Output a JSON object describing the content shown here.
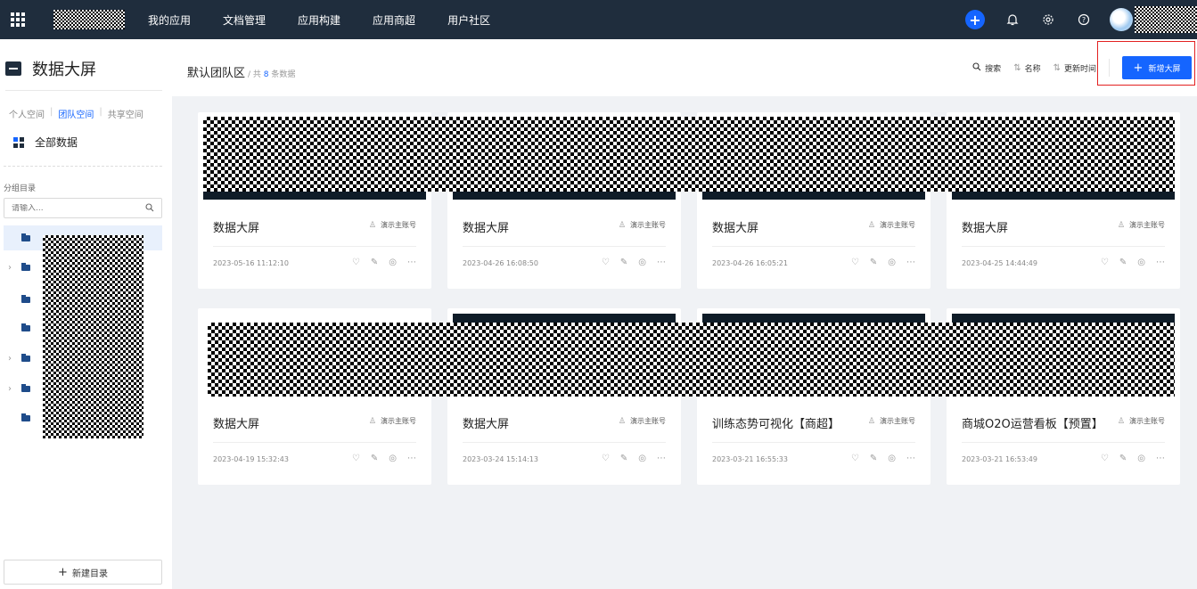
{
  "topnav": {
    "items": [
      {
        "label": "我的应用"
      },
      {
        "label": "文档管理"
      },
      {
        "label": "应用构建"
      },
      {
        "label": "应用商超"
      },
      {
        "label": "用户社区"
      }
    ],
    "icons": [
      "apps-grid-icon",
      "plus-icon",
      "bell-icon",
      "gear-icon",
      "help-icon"
    ]
  },
  "sidebar": {
    "title": "数据大屏",
    "space_tabs": [
      "个人空间",
      "团队空间",
      "共享空间"
    ],
    "active_space": "团队空间",
    "all_data": "全部数据",
    "group_label": "分组目录",
    "search_placeholder": "请输入...",
    "new_dir": "新建目录"
  },
  "header": {
    "title": "默认团队区",
    "count_prefix": "/ 共 ",
    "count": "8",
    "count_suffix": " 条数据",
    "search": "搜索",
    "sort_name": "名称",
    "sort_time": "更新时间",
    "new_button": "新增大屏"
  },
  "cards": [
    {
      "name": "数据大屏",
      "owner": "演示主账号",
      "date": "2023-05-16 11:12:10"
    },
    {
      "name": "数据大屏",
      "owner": "演示主账号",
      "date": "2023-04-26 16:08:50"
    },
    {
      "name": "数据大屏",
      "owner": "演示主账号",
      "date": "2023-04-26 16:05:21"
    },
    {
      "name": "数据大屏",
      "owner": "演示主账号",
      "date": "2023-04-25 14:44:49"
    },
    {
      "name": "数据大屏",
      "owner": "演示主账号",
      "date": "2023-04-19 15:32:43"
    },
    {
      "name": "数据大屏",
      "owner": "演示主账号",
      "date": "2023-03-24 15:14:13"
    },
    {
      "name": "训练态势可视化【商超】",
      "owner": "演示主账号",
      "date": "2023-03-21 16:55:33"
    },
    {
      "name": "商城O2O运营看板【预置】",
      "owner": "演示主账号",
      "date": "2023-03-21 16:53:49"
    }
  ],
  "colors": {
    "nav_bg": "#1f2d3d",
    "accent": "#1565ff",
    "highlight_frame": "#e32020"
  }
}
